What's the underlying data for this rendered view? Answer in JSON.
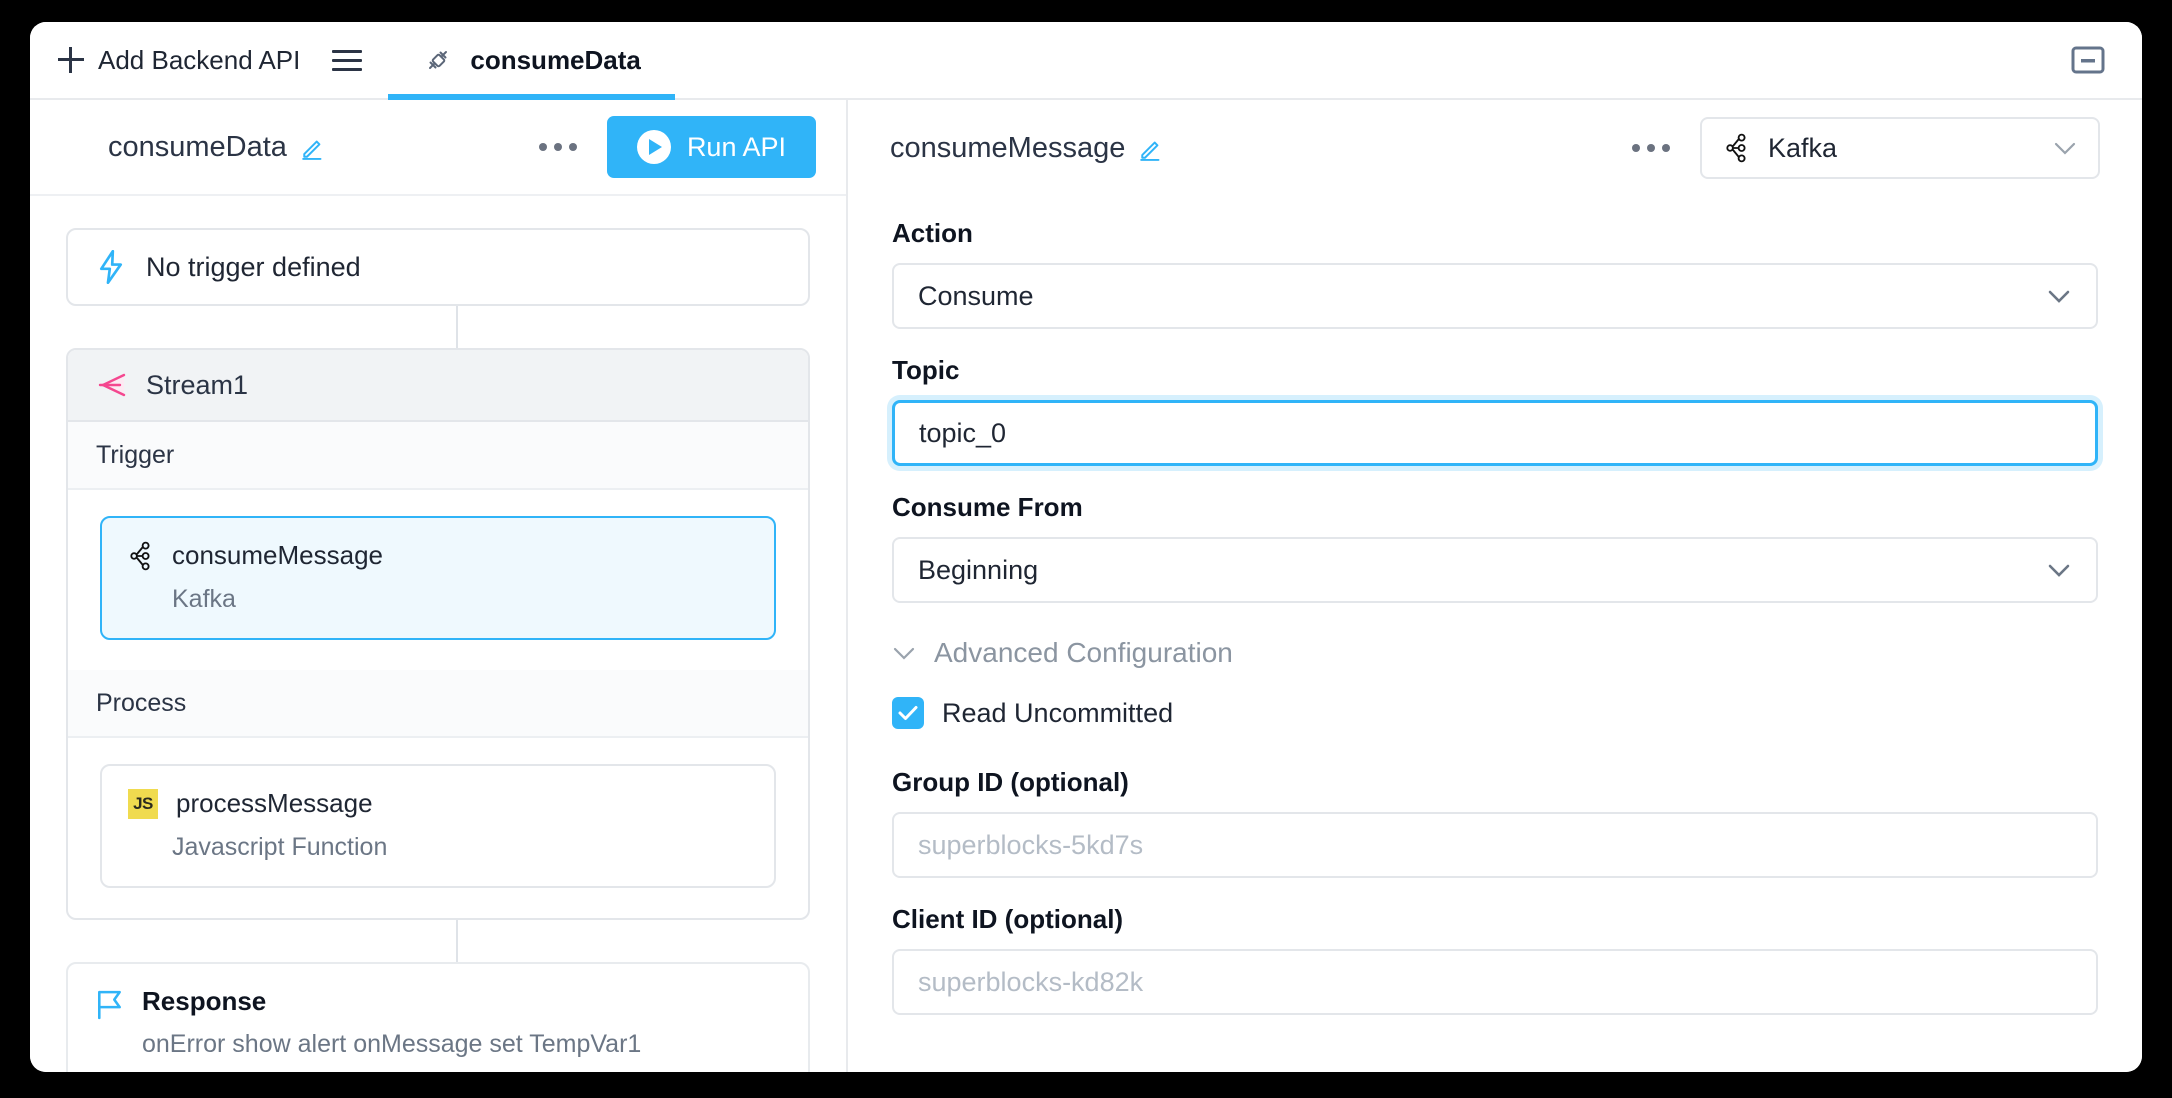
{
  "window": {
    "minimize_icon": "minimize-icon"
  },
  "tabbar": {
    "add_label": "Add Backend API",
    "add_icon": "plus-icon",
    "menu_icon": "hamburger-icon",
    "active_tab": {
      "label": "consumeData",
      "icon": "plug-icon"
    },
    "accent_color": "#30b4f8"
  },
  "left_panel": {
    "title": "consumeData",
    "edit_icon": "pencil-icon",
    "more_icon": "ellipsis-icon",
    "run_button": {
      "label": "Run API",
      "icon": "play-icon",
      "color": "#30b4f8"
    },
    "trigger_bar": {
      "label": "No trigger defined",
      "icon": "bolt-icon"
    },
    "stream": {
      "title": "Stream1",
      "icon": "stream-arrow-icon",
      "icon_color": "#f4478f",
      "sections": [
        {
          "heading": "Trigger",
          "node": {
            "title": "consumeMessage",
            "subtitle": "Kafka",
            "icon": "kafka-icon",
            "selected": true
          }
        },
        {
          "heading": "Process",
          "node": {
            "title": "processMessage",
            "subtitle": "Javascript Function",
            "icon": "js-icon",
            "selected": false
          }
        }
      ]
    },
    "response": {
      "title": "Response",
      "subtitle": "onError show alert onMessage set TempVar1",
      "icon": "flag-icon"
    }
  },
  "right_panel": {
    "title": "consumeMessage",
    "edit_icon": "pencil-icon",
    "more_icon": "ellipsis-icon",
    "integration": {
      "label": "Kafka",
      "icon": "kafka-icon",
      "chevron": "chevron-down-icon"
    },
    "fields": {
      "action": {
        "label": "Action",
        "value": "Consume",
        "chevron": "chevron-down-icon"
      },
      "topic": {
        "label": "Topic",
        "value": "topic_0",
        "placeholder": "",
        "focused": true
      },
      "consume_from": {
        "label": "Consume From",
        "value": "Beginning",
        "chevron": "chevron-down-icon"
      },
      "advanced_configuration": {
        "label": "Advanced Configuration",
        "chevron": "chevron-down-icon"
      },
      "read_uncommitted": {
        "label": "Read Uncommitted",
        "checked": true,
        "color": "#30b4f8"
      },
      "group_id": {
        "label": "Group ID (optional)",
        "value": "",
        "placeholder": "superblocks-5kd7s"
      },
      "client_id": {
        "label": "Client ID (optional)",
        "value": "",
        "placeholder": "superblocks-kd82k"
      }
    }
  }
}
